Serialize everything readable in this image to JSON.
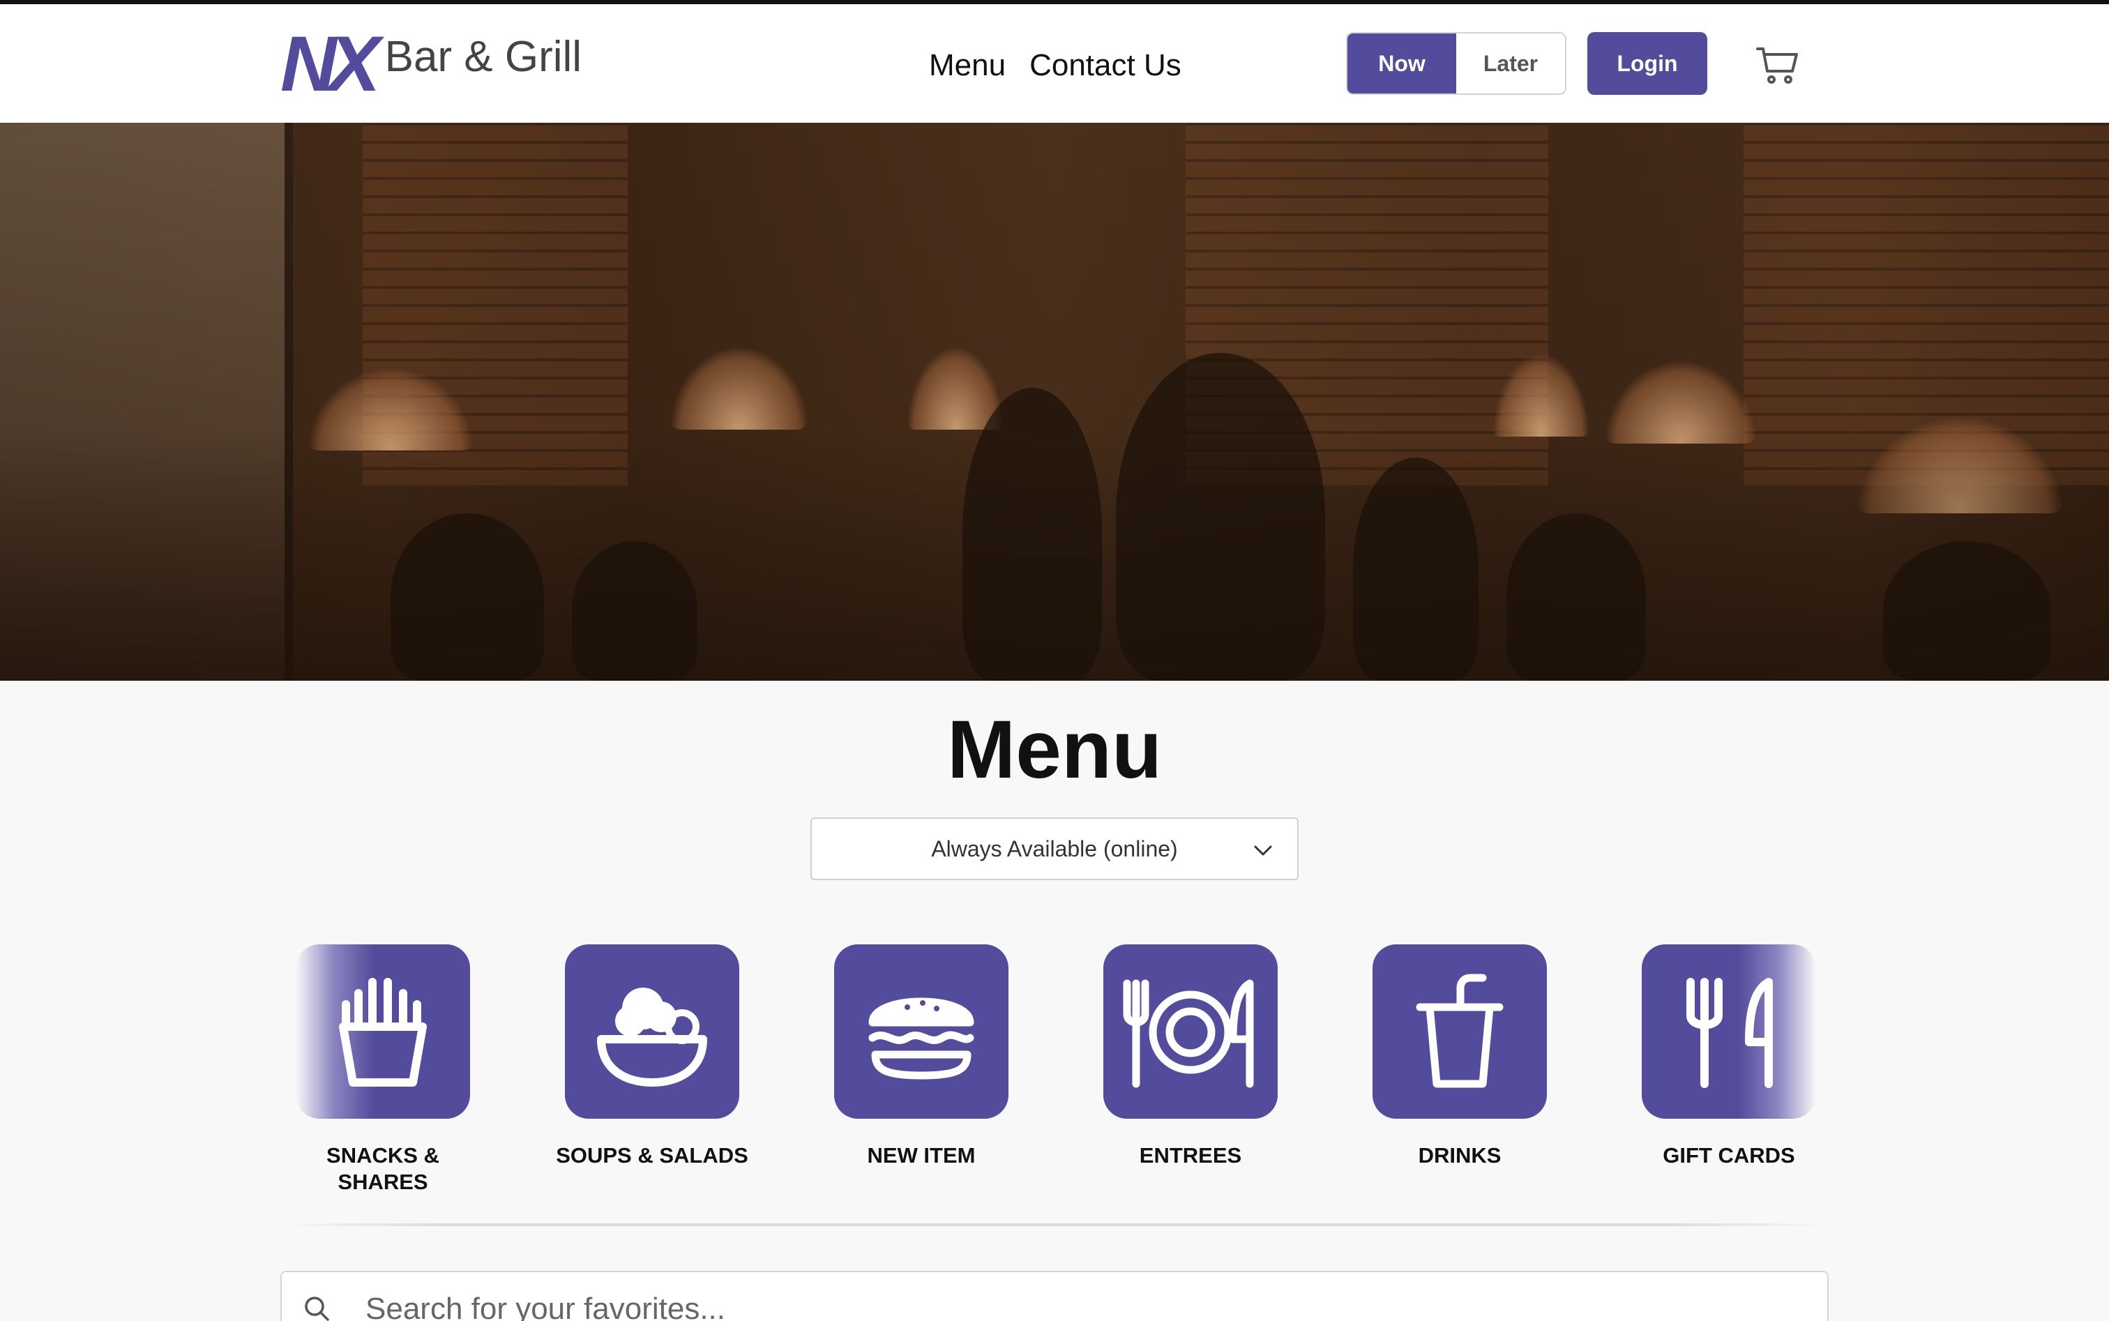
{
  "brand": {
    "logo_mark": "NX",
    "logo_text": "Bar & Grill",
    "accent": "#534b9c"
  },
  "nav": {
    "items": [
      {
        "label": "Menu"
      },
      {
        "label": "Contact Us"
      }
    ]
  },
  "order_toggle": {
    "now": "Now",
    "later": "Later",
    "selected": "Now"
  },
  "login": {
    "label": "Login"
  },
  "cart": {
    "icon": "cart-icon"
  },
  "hero": {
    "image": "restaurant-interior"
  },
  "page": {
    "title": "Menu"
  },
  "menu_select": {
    "value": "Always Available (online)"
  },
  "categories": [
    {
      "label": "Snacks & Shares",
      "icon": "fries-icon"
    },
    {
      "label": "Soups & Salads",
      "icon": "salad-bowl-icon"
    },
    {
      "label": "New Item",
      "icon": "burger-icon"
    },
    {
      "label": "Entrees",
      "icon": "plate-fork-knife-icon"
    },
    {
      "label": "Drinks",
      "icon": "drink-cup-icon"
    },
    {
      "label": "Gift Cards",
      "icon": "fork-knife-icon"
    }
  ],
  "search": {
    "placeholder": "Search for your favorites..."
  }
}
